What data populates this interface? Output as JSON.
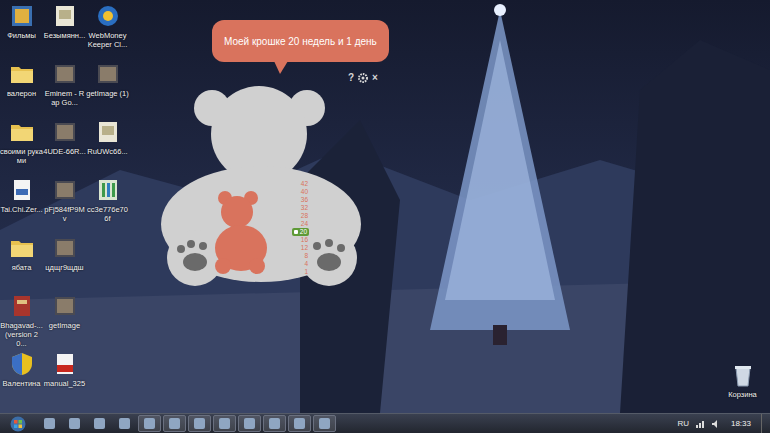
{
  "desktop": {
    "icon_rows": [
      [
        {
          "label": "Фильмы",
          "kind": "video"
        },
        {
          "label": "Безымянн...",
          "kind": "picture"
        },
        {
          "label": "WebMoney Keeper Cl...",
          "kind": "app"
        }
      ],
      [
        {
          "label": "валерон",
          "kind": "folder"
        },
        {
          "label": "Eminem - Rap Go...",
          "kind": "image"
        },
        {
          "label": "getImage (1)",
          "kind": "image"
        }
      ],
      [
        {
          "label": "своими руками",
          "kind": "folder"
        },
        {
          "label": "4UDE-66R...",
          "kind": "image"
        },
        {
          "label": "RuUWc66...",
          "kind": "picture"
        }
      ],
      [
        {
          "label": "Tai.Chi.Zer...",
          "kind": "document"
        },
        {
          "label": "pFj584fP9Mv",
          "kind": "image"
        },
        {
          "label": "cc3e776e706f",
          "kind": "archive"
        }
      ],
      [
        {
          "label": "ябата",
          "kind": "folder"
        },
        {
          "label": "цдщг9щдш",
          "kind": "image"
        }
      ],
      [
        {
          "label": "Bhagavad-... (version 20...",
          "kind": "book"
        },
        {
          "label": "getImage",
          "kind": "image"
        }
      ],
      [
        {
          "label": "Валентина",
          "kind": "shield"
        },
        {
          "label": "manual_325",
          "kind": "pdf"
        }
      ]
    ]
  },
  "recycle_bin": {
    "label": "Корзина"
  },
  "gadget": {
    "message": "Моей крошке 20 недель и 1 день",
    "controls": [
      {
        "kind": "text",
        "label": "?"
      },
      {
        "kind": "gear"
      },
      {
        "kind": "text",
        "label": "×"
      }
    ],
    "scale": [
      {
        "value": "42",
        "selected": false
      },
      {
        "value": "40",
        "selected": false
      },
      {
        "value": "36",
        "selected": false
      },
      {
        "value": "32",
        "selected": false
      },
      {
        "value": "28",
        "selected": false
      },
      {
        "value": "24",
        "selected": false
      },
      {
        "value": "20",
        "selected": true
      },
      {
        "value": "16",
        "selected": false
      },
      {
        "value": "12",
        "selected": false
      },
      {
        "value": "8",
        "selected": false
      },
      {
        "value": "4",
        "selected": false
      },
      {
        "value": "1",
        "selected": false
      }
    ]
  },
  "taskbar": {
    "items": [
      {
        "running": false
      },
      {
        "running": false
      },
      {
        "running": false
      },
      {
        "running": false
      },
      {
        "running": true
      },
      {
        "running": true
      },
      {
        "running": true
      },
      {
        "running": true
      },
      {
        "running": true
      },
      {
        "running": true
      },
      {
        "running": true
      },
      {
        "running": true
      }
    ],
    "language": "RU",
    "time": "18:33"
  }
}
